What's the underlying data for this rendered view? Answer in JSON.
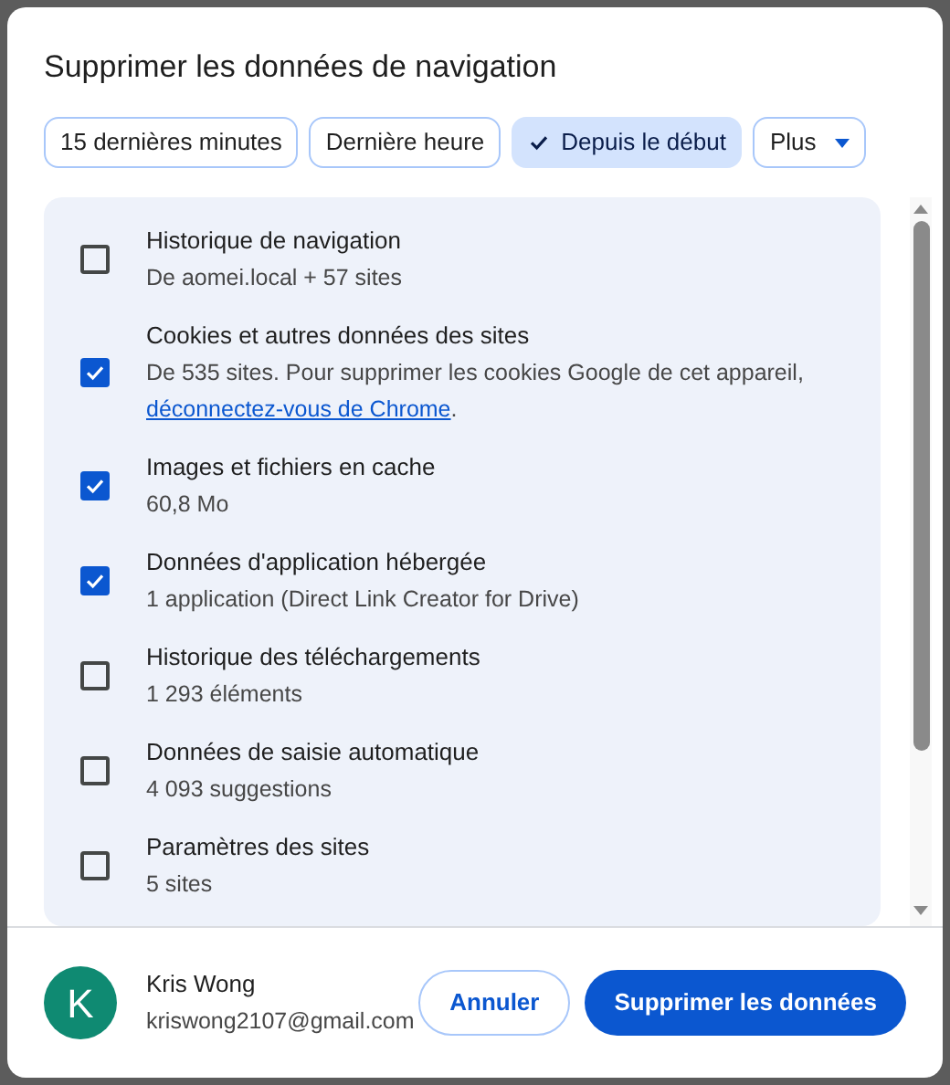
{
  "dialog": {
    "title": "Supprimer les données de navigation"
  },
  "time_ranges": [
    {
      "label": "15 dernières minutes",
      "selected": false
    },
    {
      "label": "Dernière heure",
      "selected": false
    },
    {
      "label": "Depuis le début",
      "selected": true
    }
  ],
  "more_menu": {
    "label": "Plus"
  },
  "items": [
    {
      "title": "Historique de navigation",
      "detail": "De aomei.local + 57 sites",
      "checked": false
    },
    {
      "title": "Cookies et autres données des sites",
      "detail": "De 535 sites. Pour supprimer les cookies Google de cet appareil,",
      "link": "déconnectez-vous de Chrome",
      "after_link": ".",
      "checked": true
    },
    {
      "title": "Images et fichiers en cache",
      "detail": "60,8 Mo",
      "checked": true
    },
    {
      "title": "Données d'application hébergée",
      "detail": "1 application (Direct Link Creator for Drive)",
      "checked": true
    },
    {
      "title": "Historique des téléchargements",
      "detail": "1 293 éléments",
      "checked": false
    },
    {
      "title": "Données de saisie automatique",
      "detail": "4 093 suggestions",
      "checked": false
    },
    {
      "title": "Paramètres des sites",
      "detail": "5 sites",
      "checked": false
    }
  ],
  "account": {
    "initial": "K",
    "name": "Kris Wong",
    "email": "kriswong2107@gmail.com"
  },
  "buttons": {
    "cancel": "Annuler",
    "confirm": "Supprimer les données"
  }
}
